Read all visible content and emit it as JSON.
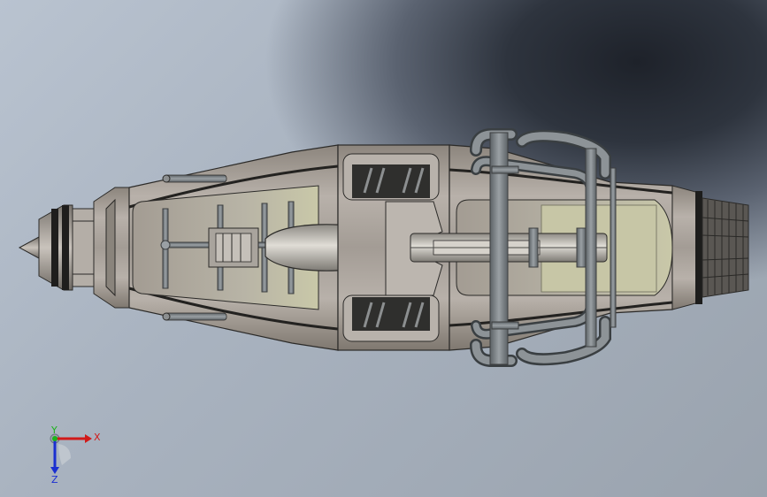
{
  "viewport": {
    "name": "3d-graphics-area"
  },
  "triad": {
    "x_label": "X",
    "y_label": "Y",
    "z_label": "Z",
    "x_color": "#d11a1a",
    "y_color": "#1db31d",
    "z_color": "#1a2fd1"
  },
  "colors": {
    "body_metal": "#a59e97",
    "body_dark": "#3b3a38",
    "pipe": "#7a8084",
    "inner_panel": "#c8c6a4"
  }
}
